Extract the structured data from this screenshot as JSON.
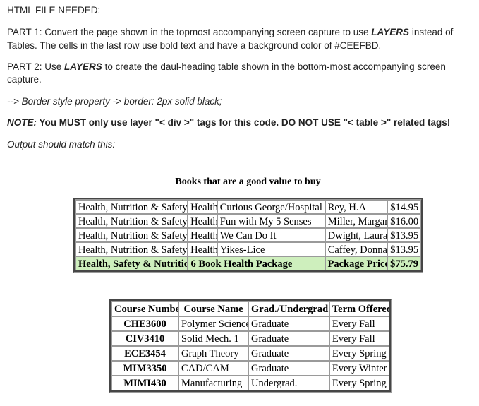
{
  "instructions": {
    "heading": "HTML FILE NEEDED:",
    "part1_prefix": "PART 1: Convert the page shown in the topmost accompanying screen capture to use ",
    "part1_emphasis": "LAYERS",
    "part1_suffix": " instead of Tables. The cells in the last row use bold text and have a background color of #CEEFBD.",
    "part2_prefix": "PART 2: Use ",
    "part2_emphasis": "LAYERS",
    "part2_suffix": " to create the daul-heading table shown in the bottom-most accompanying screen capture.",
    "border_note": "--> Border style property -> border: 2px solid black;",
    "note_label": "NOTE:",
    "note_text": " You MUST only use layer \"< div >\" tags for this code. DO NOT USE  \"< table >\" related tags!",
    "output_line": "Output should match this:"
  },
  "books_table": {
    "title": "Books that are a good value to buy",
    "rows": [
      {
        "category": "Health, Nutrition & Safety",
        "subject": "Health",
        "title": "Curious George/Hospital",
        "author": "Rey, H.A",
        "price": "$14.95"
      },
      {
        "category": "Health, Nutrition & Safety",
        "subject": "Health",
        "title": "Fun with My 5 Senses",
        "author": "Miller, Margaret",
        "price": "$16.00"
      },
      {
        "category": "Health, Nutrition & Safety",
        "subject": "Health",
        "title": "We Can Do It",
        "author": "Dwight, Laura",
        "price": "$13.95"
      },
      {
        "category": "Health, Nutrition & Safety",
        "subject": "Health",
        "title": "Yikes-Lice",
        "author": "Caffey, Donna",
        "price": "$13.95"
      }
    ],
    "package_row": {
      "category": "Health, Safety & Nutrition",
      "package": "6 Book Health Package",
      "label": "Package Price",
      "price": "$75.79",
      "background_color": "#CEEFBD"
    }
  },
  "courses_table": {
    "headers": [
      "Course Number",
      "Course Name",
      "Grad./Undergrad.",
      "Term Offered"
    ],
    "rows": [
      {
        "number": "CHE3600",
        "name": "Polymer Science",
        "level": "Graduate",
        "term": "Every Fall"
      },
      {
        "number": "CIV3410",
        "name": "Solid Mech. 1",
        "level": "Graduate",
        "term": "Every Fall"
      },
      {
        "number": "ECE3454",
        "name": "Graph Theory",
        "level": "Graduate",
        "term": "Every Spring"
      },
      {
        "number": "MIM3350",
        "name": "CAD/CAM",
        "level": "Graduate",
        "term": "Every Winter"
      },
      {
        "number": "MIMI430",
        "name": "Manufacturing",
        "level": "Undergrad.",
        "term": "Every Spring"
      }
    ]
  }
}
